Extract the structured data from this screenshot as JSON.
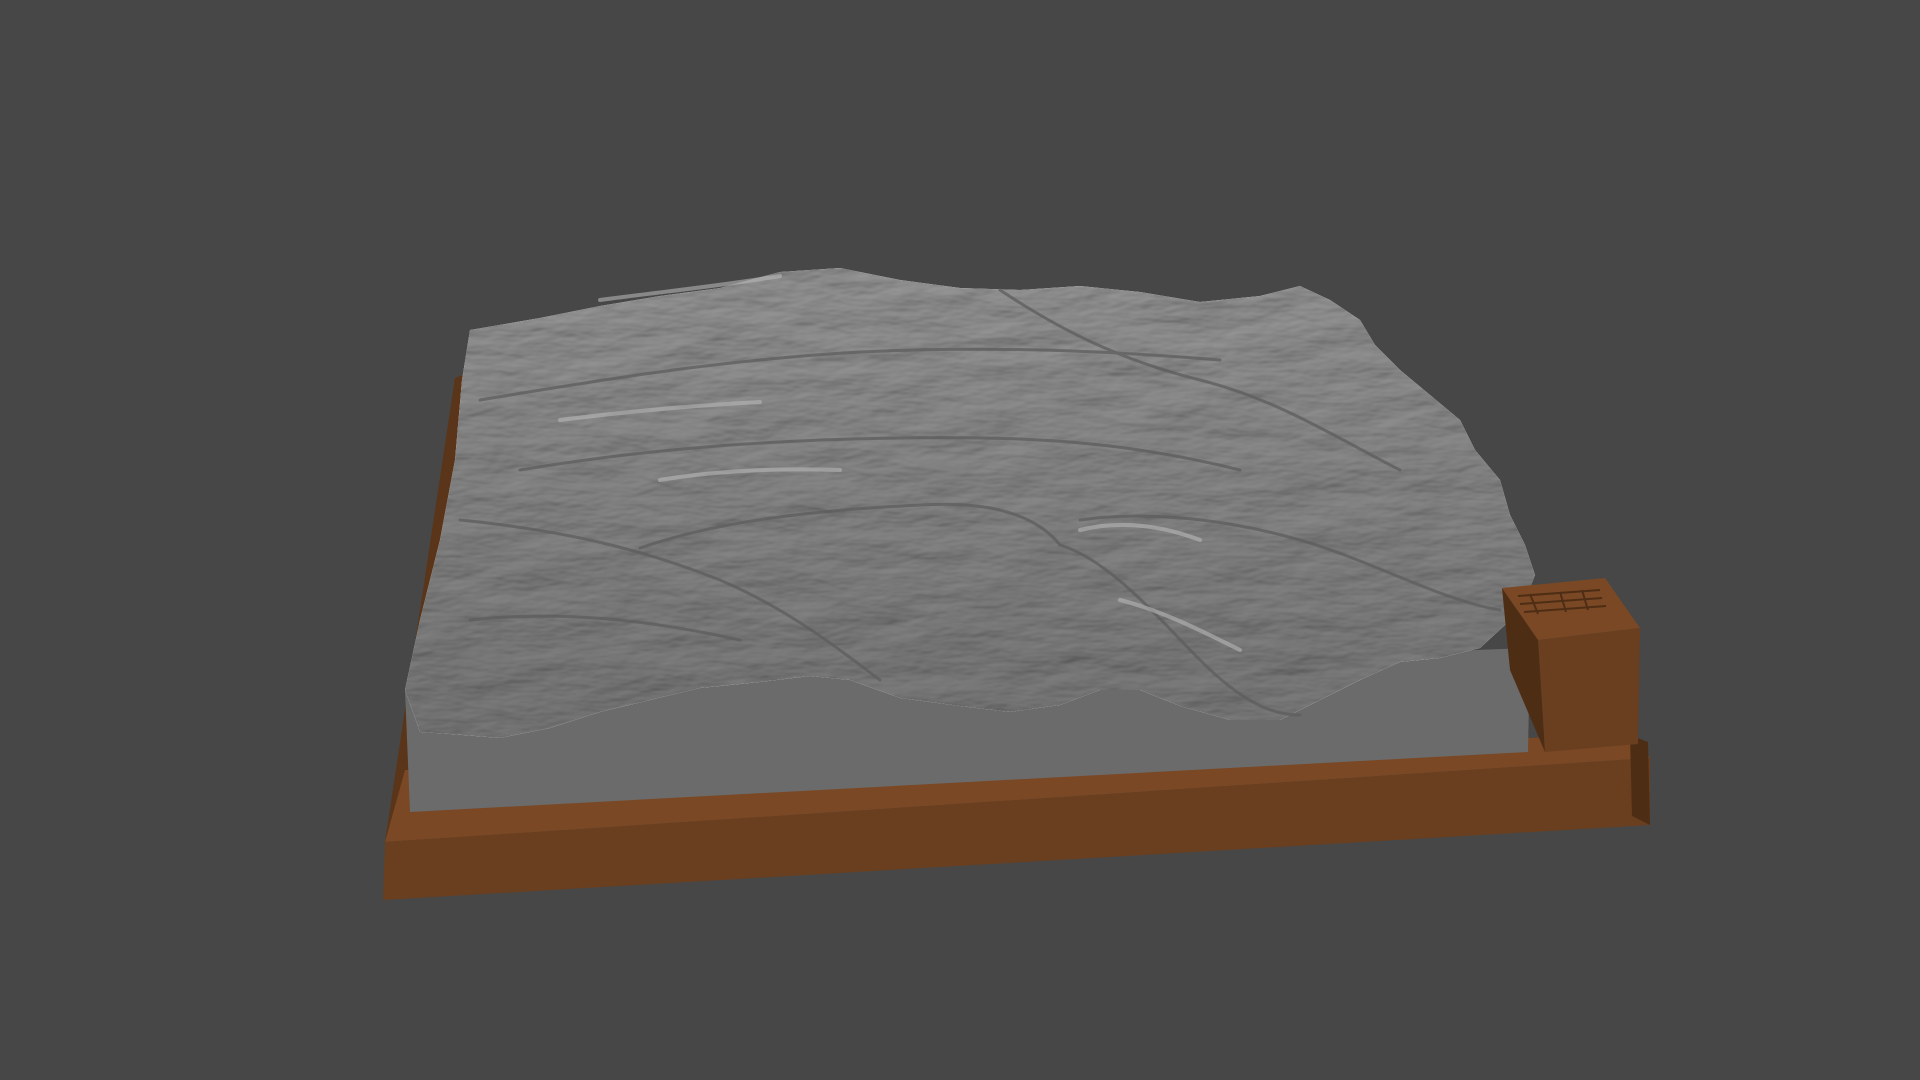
{
  "viewport": {
    "background_color": "#474747"
  },
  "model": {
    "subject": "terrain relief",
    "terrain_color": "#8e8e8e",
    "terrain_shadow_color": "#6a6a6a",
    "terrain_highlight_color": "#c4c4c4",
    "base_wall_color": "#6b6b6b",
    "frame_color": "#6a3f1f",
    "frame_dark_color": "#4e2d15",
    "frame_light_color": "#7a4824"
  }
}
